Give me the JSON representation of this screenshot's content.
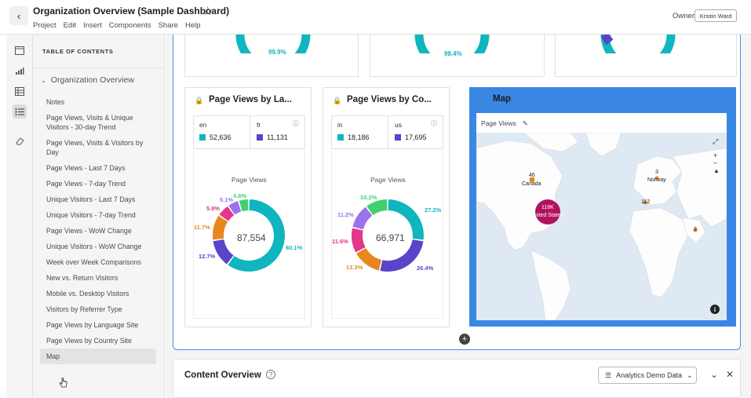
{
  "header": {
    "title": "Organization Overview (Sample Dashboard)",
    "menu": [
      "Project",
      "Edit",
      "Insert",
      "Components",
      "Share",
      "Help"
    ],
    "owner_label": "Owner",
    "owner_name": "Kristin Ward"
  },
  "toc": {
    "title": "TABLE OF CONTENTS",
    "section": "Organization Overview",
    "items": [
      "Notes",
      "Page Views, Visits & Unique Visitors - 30-day Trend",
      "Page Views, Visits & Visitors by Day",
      "Page Views - Last 7 Days",
      "Page Views - 7-day Trend",
      "Unique Visitors - Last 7 Days",
      "Unique Visitors - 7-day Trend",
      "Page Views - WoW Change",
      "Unique Visitors - WoW Change",
      "Week over Week Comparisons",
      "New vs. Return Visitors",
      "Mobile vs. Desktop Visitors",
      "Visitors by Referrer Type",
      "Page Views by Language Site",
      "Page Views by Country Site",
      "Map"
    ]
  },
  "top_cards": {
    "pcts": [
      "99.9%",
      "98.4%"
    ]
  },
  "language_card": {
    "title": "Page Views by La...",
    "kpis": [
      {
        "label": "en",
        "value": "52,636",
        "color": "#0fb5bf"
      },
      {
        "label": "fr",
        "value": "11,131",
        "color": "#5a44c9"
      }
    ],
    "donut_title": "Page Views",
    "total": "87,554",
    "labels": [
      "60.1%",
      "12.7%",
      "11.7%",
      "5.8%",
      "5.1%",
      "4.6%"
    ]
  },
  "country_card": {
    "title": "Page Views by Co...",
    "kpis": [
      {
        "label": "in",
        "value": "18,186",
        "color": "#0fb5bf"
      },
      {
        "label": "us",
        "value": "17,695",
        "color": "#5a44c9"
      }
    ],
    "donut_title": "Page Views",
    "total": "66,971",
    "labels": [
      "27.2%",
      "26.4%",
      "13.3%",
      "11.6%",
      "11.2%",
      "10.2%"
    ]
  },
  "map_card": {
    "title": "Map",
    "metric": "Page Views",
    "markers": [
      {
        "label": "Canada",
        "value": "46"
      },
      {
        "label": "United States",
        "value": "118K"
      },
      {
        "label": "Norway",
        "value": "3"
      },
      {
        "label": "",
        "value": "112"
      },
      {
        "label": "",
        "value": "3"
      }
    ]
  },
  "content_panel": {
    "title": "Content Overview",
    "data_source": "Analytics Demo Data"
  },
  "chart_data": [
    {
      "type": "pie",
      "categories": [
        "en",
        "fr",
        "",
        "",
        "",
        ""
      ],
      "values": [
        60.1,
        12.7,
        11.7,
        5.8,
        5.1,
        4.6
      ],
      "colors": [
        "#0fb5bf",
        "#5a44c9",
        "#e8861f",
        "#e2378a",
        "#9b72ea",
        "#3ed16e"
      ],
      "title": "Page Views"
    },
    {
      "type": "pie",
      "categories": [
        "in",
        "us",
        "",
        "",
        "",
        ""
      ],
      "values": [
        27.2,
        26.4,
        13.3,
        11.6,
        11.2,
        10.2
      ],
      "colors": [
        "#0fb5bf",
        "#5a44c9",
        "#e8861f",
        "#e2378a",
        "#9b72ea",
        "#3ed16e"
      ],
      "title": "Page Views"
    }
  ]
}
